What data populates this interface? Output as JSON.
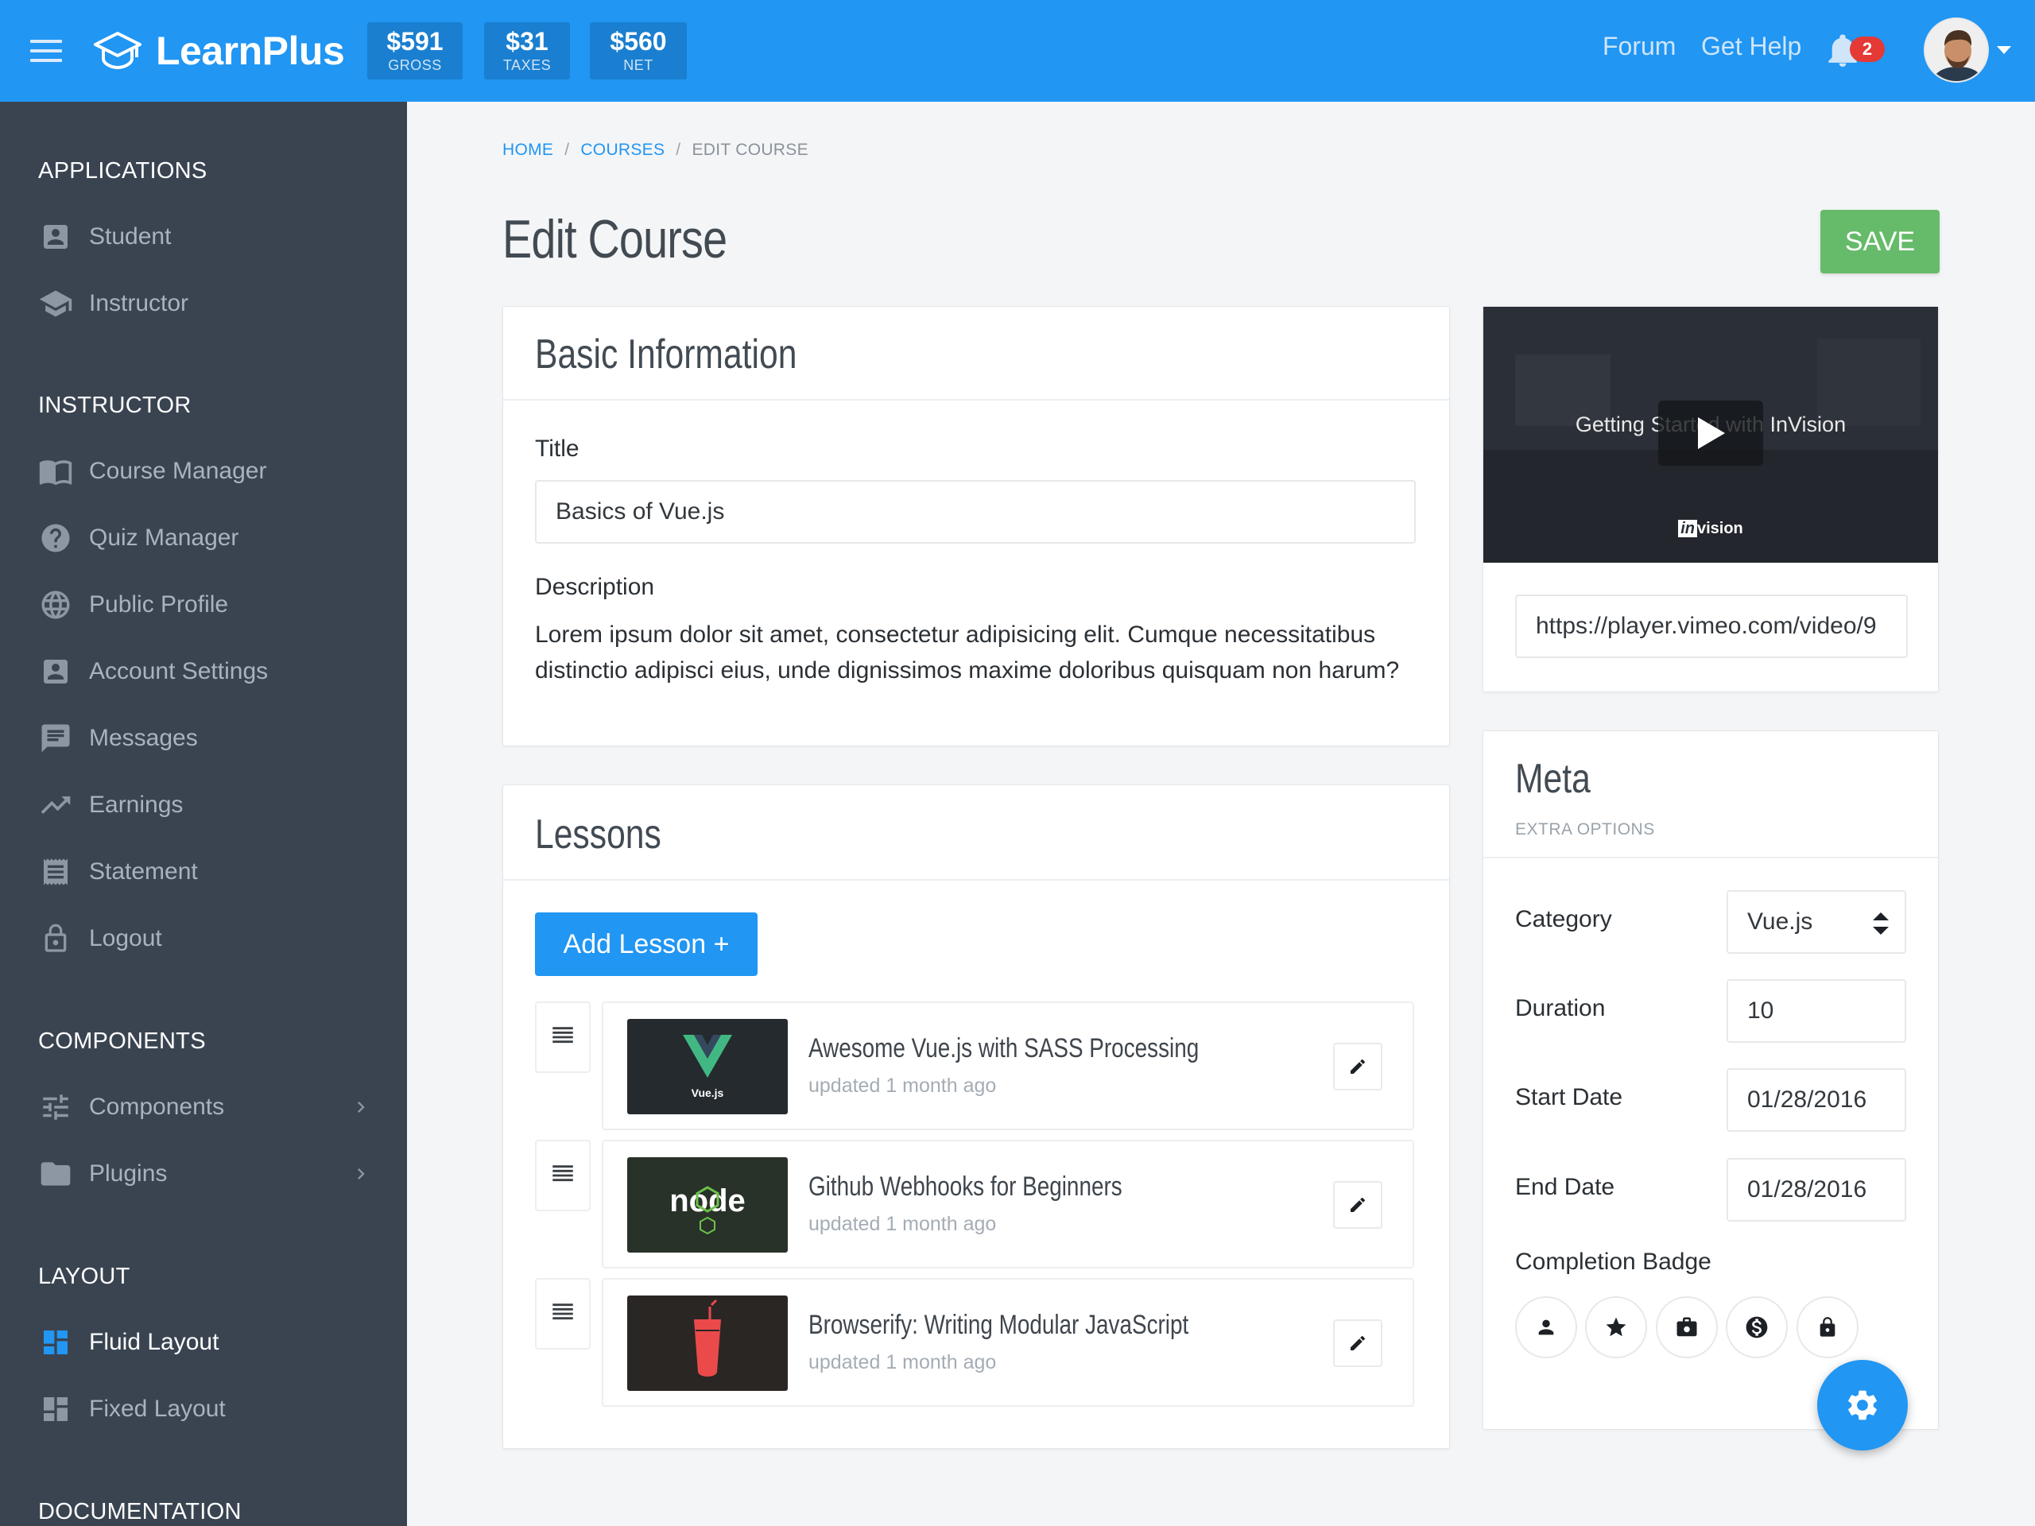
{
  "topbar": {
    "brand": "LearnPlus",
    "stats": [
      {
        "value": "$591",
        "label": "GROSS"
      },
      {
        "value": "$31",
        "label": "TAXES"
      },
      {
        "value": "$560",
        "label": "NET"
      }
    ],
    "nav": {
      "forum": "Forum",
      "help": "Get Help"
    },
    "notification_count": "2"
  },
  "sidebar": {
    "sections": {
      "applications": "APPLICATIONS",
      "instructor": "INSTRUCTOR",
      "components": "COMPONENTS",
      "layout": "LAYOUT",
      "documentation": "DOCUMENTATION"
    },
    "applications": [
      {
        "label": "Student",
        "icon": "account-box-icon"
      },
      {
        "label": "Instructor",
        "icon": "school-icon"
      }
    ],
    "instructor": [
      {
        "label": "Course Manager",
        "icon": "book-icon"
      },
      {
        "label": "Quiz Manager",
        "icon": "help-circle-icon"
      },
      {
        "label": "Public Profile",
        "icon": "globe-icon"
      },
      {
        "label": "Account Settings",
        "icon": "account-box-icon"
      },
      {
        "label": "Messages",
        "icon": "message-icon"
      },
      {
        "label": "Earnings",
        "icon": "trending-up-icon"
      },
      {
        "label": "Statement",
        "icon": "receipt-icon"
      },
      {
        "label": "Logout",
        "icon": "lock-open-icon"
      }
    ],
    "components": [
      {
        "label": "Components",
        "icon": "tune-icon"
      },
      {
        "label": "Plugins",
        "icon": "folder-icon"
      }
    ],
    "layout": [
      {
        "label": "Fluid Layout",
        "icon": "dashboard-icon",
        "active": true
      },
      {
        "label": "Fixed Layout",
        "icon": "dashboard-icon",
        "active": false
      }
    ]
  },
  "breadcrumb": {
    "home": "HOME",
    "courses": "COURSES",
    "current": "EDIT COURSE"
  },
  "page": {
    "title": "Edit Course",
    "save_label": "SAVE"
  },
  "basic_info": {
    "heading": "Basic Information",
    "title_label": "Title",
    "title_value": "Basics of Vue.js",
    "description_label": "Description",
    "description_value": "Lorem ipsum dolor sit amet, consectetur adipisicing elit. Cumque necessitatibus distinctio adipisci eius, unde dignissimos maxime doloribus quisquam non harum?"
  },
  "lessons": {
    "heading": "Lessons",
    "add_label": "Add Lesson",
    "add_icon": "+",
    "items": [
      {
        "title": "Awesome Vue.js with SASS Processing",
        "updated": "updated 1 month ago",
        "thumb": "vuejs-logo",
        "thumb_text": "Vue.js",
        "thumb_bg": "#252a2e"
      },
      {
        "title": "Github Webhooks for Beginners",
        "updated": "updated 1 month ago",
        "thumb": "nodejs-logo",
        "thumb_text": "node",
        "thumb_bg": "#283228"
      },
      {
        "title": "Browserify: Writing Modular JavaScript",
        "updated": "updated 1 month ago",
        "thumb": "gulp-logo",
        "thumb_text": "",
        "thumb_bg": "#2a2624"
      }
    ]
  },
  "video": {
    "title": "Getting Started with InVision",
    "brand": "vision",
    "brand_prefix": "in",
    "url": "https://player.vimeo.com/video/9"
  },
  "meta": {
    "heading": "Meta",
    "subheading": "EXTRA OPTIONS",
    "category_label": "Category",
    "category_value": "Vue.js",
    "duration_label": "Duration",
    "duration_value": "10",
    "start_label": "Start Date",
    "start_value": "01/28/2016",
    "end_label": "End Date",
    "end_value": "01/28/2016",
    "badge_label": "Completion Badge",
    "badges": [
      "person-icon",
      "star-icon",
      "briefcase-icon",
      "dollar-icon",
      "lock-icon"
    ]
  },
  "colors": {
    "primary": "#2196f3",
    "success": "#66bb6a",
    "sidebar": "#3a4451",
    "danger": "#e53935"
  }
}
